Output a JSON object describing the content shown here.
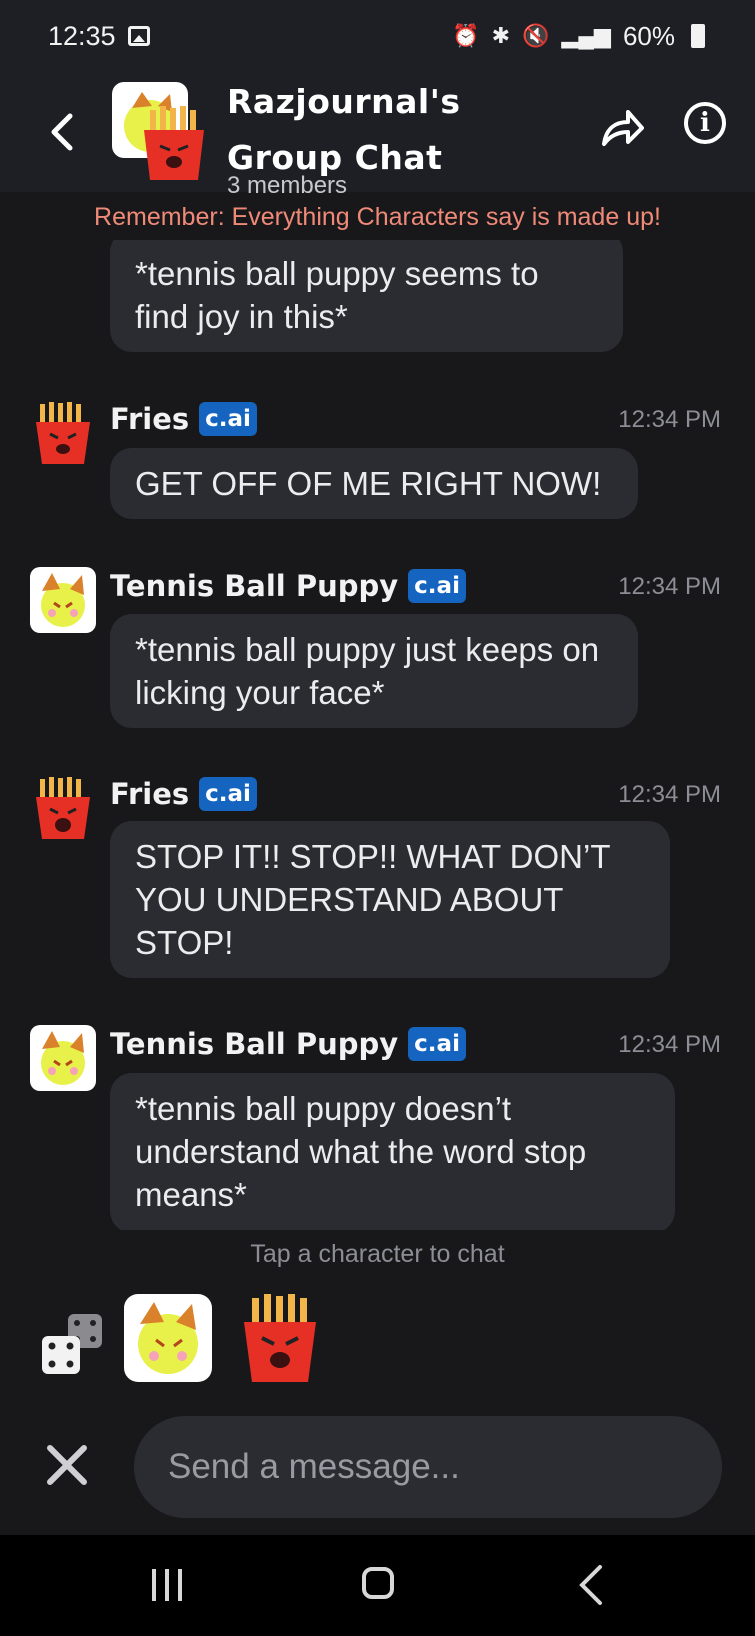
{
  "status_bar": {
    "time": "12:35",
    "battery_pct": "60%"
  },
  "header": {
    "title_line1": "Razjournal's",
    "title_line2": "Group Chat",
    "members": "3 members"
  },
  "disclaimer": "Remember: Everything Characters say is made up!",
  "messages": [
    {
      "text": "*tennis ball puppy seems to find joy in this*",
      "partial": true
    },
    {
      "author": "Fries",
      "badge": "c.ai",
      "time": "12:34 PM",
      "text": "GET OFF OF ME RIGHT NOW!"
    },
    {
      "author": "Tennis Ball Puppy",
      "badge": "c.ai",
      "time": "12:34 PM",
      "text": "*tennis ball puppy just keeps on licking your face*"
    },
    {
      "author": "Fries",
      "badge": "c.ai",
      "time": "12:34 PM",
      "text": "STOP IT!! STOP!! WHAT DON’T YOU UNDERSTAND ABOUT STOP!"
    },
    {
      "author": "Tennis Ball Puppy",
      "badge": "c.ai",
      "time": "12:34 PM",
      "text": "*tennis ball puppy doesn’t understand what the word stop means*"
    }
  ],
  "hint": "Tap a character to chat",
  "composer": {
    "placeholder": "Send a message..."
  },
  "icons": {
    "back": "chevron-left-icon",
    "share": "share-arrow-icon",
    "info": "info-icon",
    "dice": "dice-icon",
    "close": "close-icon"
  },
  "colors": {
    "background": "#18181b",
    "bubble": "#2b2c31",
    "badge": "#1565c0",
    "disclaimer": "#f08a78"
  }
}
